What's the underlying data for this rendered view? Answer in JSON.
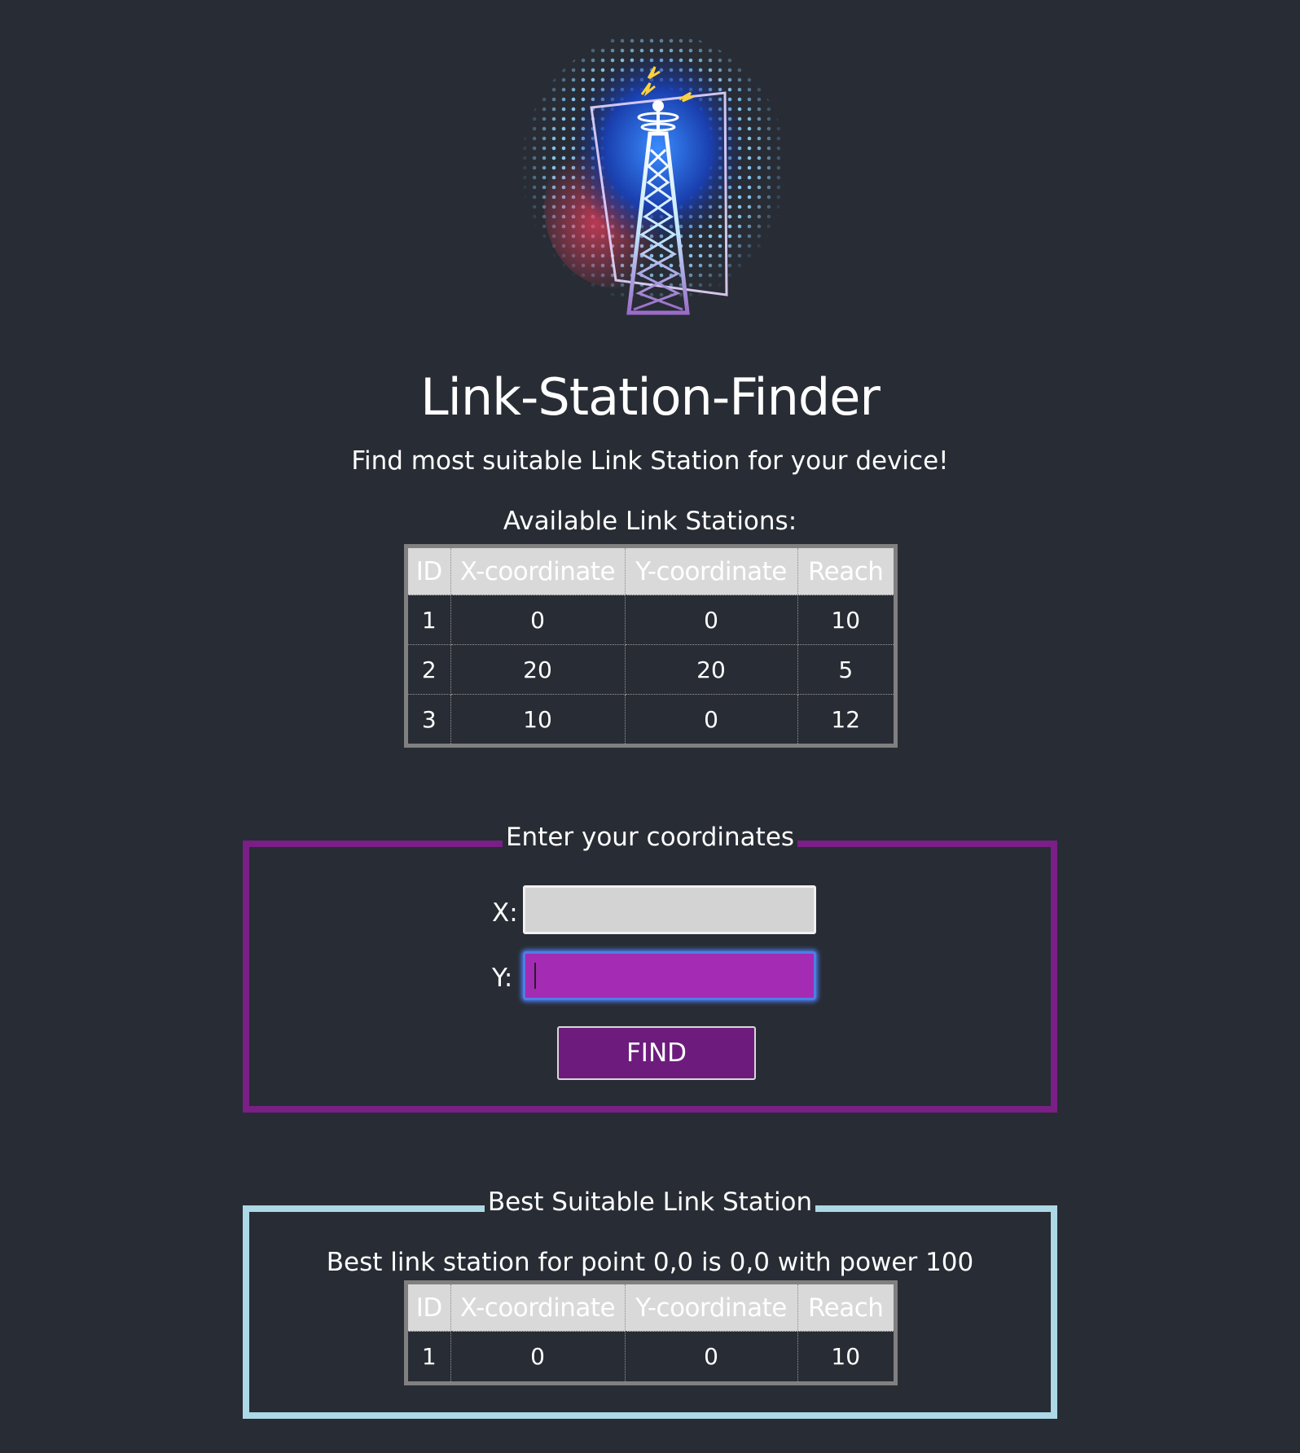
{
  "logo": {
    "description_icon": "radio-tower-logo",
    "colors": {
      "glow_blue": "#1e5bd8",
      "glow_red": "#c0364a",
      "dots": "#8fd3ff",
      "tower": "#e8f4ff"
    }
  },
  "header": {
    "title": "Link-Station-Finder",
    "subtitle": "Find most suitable Link Station for your device!"
  },
  "stations": {
    "heading": "Available Link Stations:",
    "columns": [
      "ID",
      "X-coordinate",
      "Y-coordinate",
      "Reach"
    ],
    "rows": [
      [
        "1",
        "0",
        "0",
        "10"
      ],
      [
        "2",
        "20",
        "20",
        "5"
      ],
      [
        "3",
        "10",
        "0",
        "12"
      ]
    ]
  },
  "form": {
    "legend": "Enter your coordinates",
    "x_label": "X:",
    "y_label": "Y:",
    "x_value": "",
    "y_value": "",
    "find_label": "FIND",
    "border_color": "#7a1f86"
  },
  "result": {
    "legend": "Best Suitable Link Station",
    "message": "Best link station for point 0,0 is 0,0 with power 100",
    "columns": [
      "ID",
      "X-coordinate",
      "Y-coordinate",
      "Reach"
    ],
    "rows": [
      [
        "1",
        "0",
        "0",
        "10"
      ]
    ],
    "border_color": "#add8e6"
  }
}
